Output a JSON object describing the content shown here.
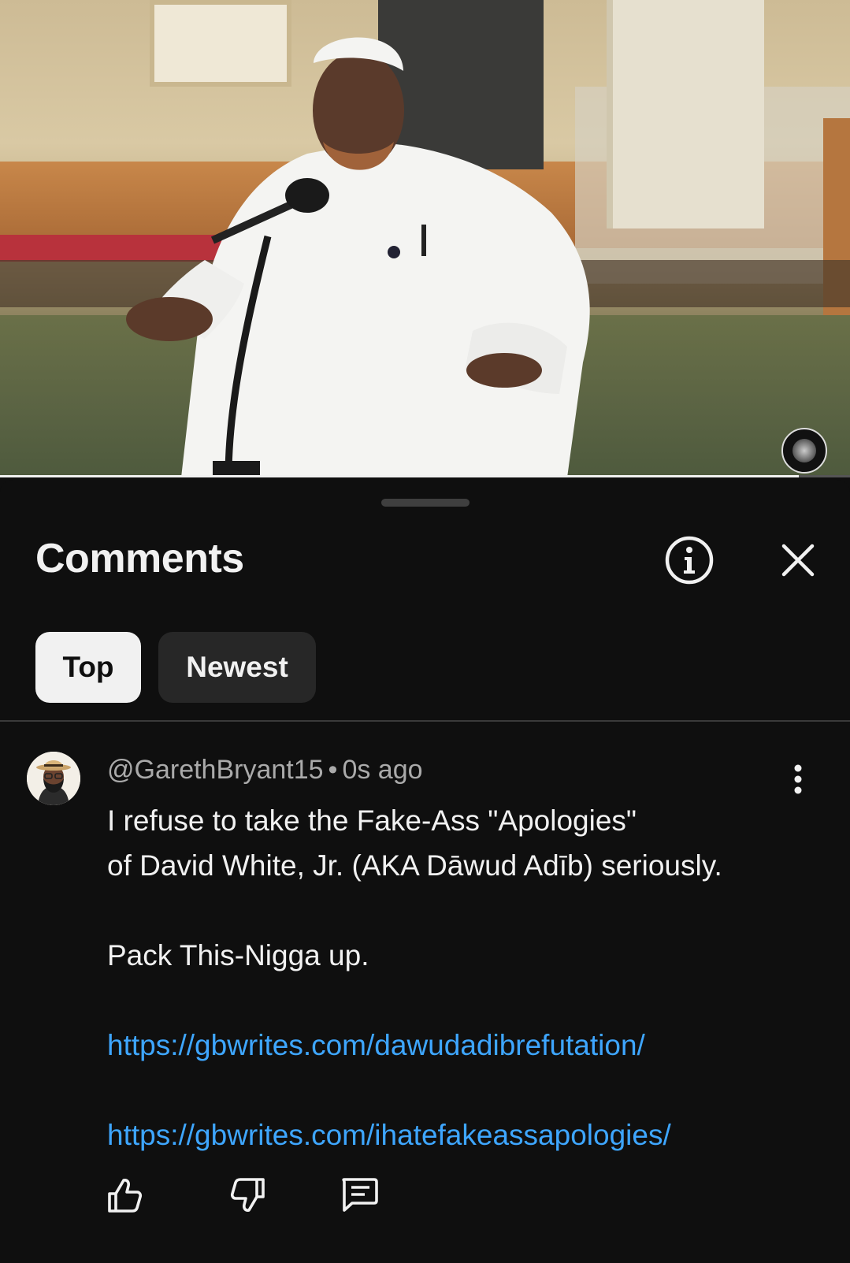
{
  "video": {
    "progress_fraction": 0.94,
    "watermark_icon": "podcast-logo-icon"
  },
  "sheet": {
    "title": "Comments",
    "info_icon": "info-icon",
    "close_icon": "close-icon",
    "sort_chips": [
      {
        "label": "Top",
        "selected": true
      },
      {
        "label": "Newest",
        "selected": false
      }
    ]
  },
  "comment": {
    "author": "@GarethBryant15",
    "separator": "•",
    "time": "0s ago",
    "lines": [
      "I refuse to take the Fake-Ass \"Apologies\"",
      "of David White, Jr. (AKA Dāwud Adīb) seriously.",
      "Pack This-Nigga up."
    ],
    "links": [
      "https://gbwrites.com/dawudadibrefutation/",
      "https://gbwrites.com/ihatefakeassapologies/"
    ],
    "actions": {
      "like_icon": "thumbs-up-icon",
      "dislike_icon": "thumbs-down-icon",
      "reply_icon": "reply-icon",
      "more_icon": "more-vertical-icon"
    }
  },
  "colors": {
    "background": "#0f0f0f",
    "text": "#f1f1f1",
    "meta": "#aaaaaa",
    "link": "#3ea6ff",
    "chip_selected_bg": "#f1f1f1",
    "chip_bg": "#272727"
  }
}
